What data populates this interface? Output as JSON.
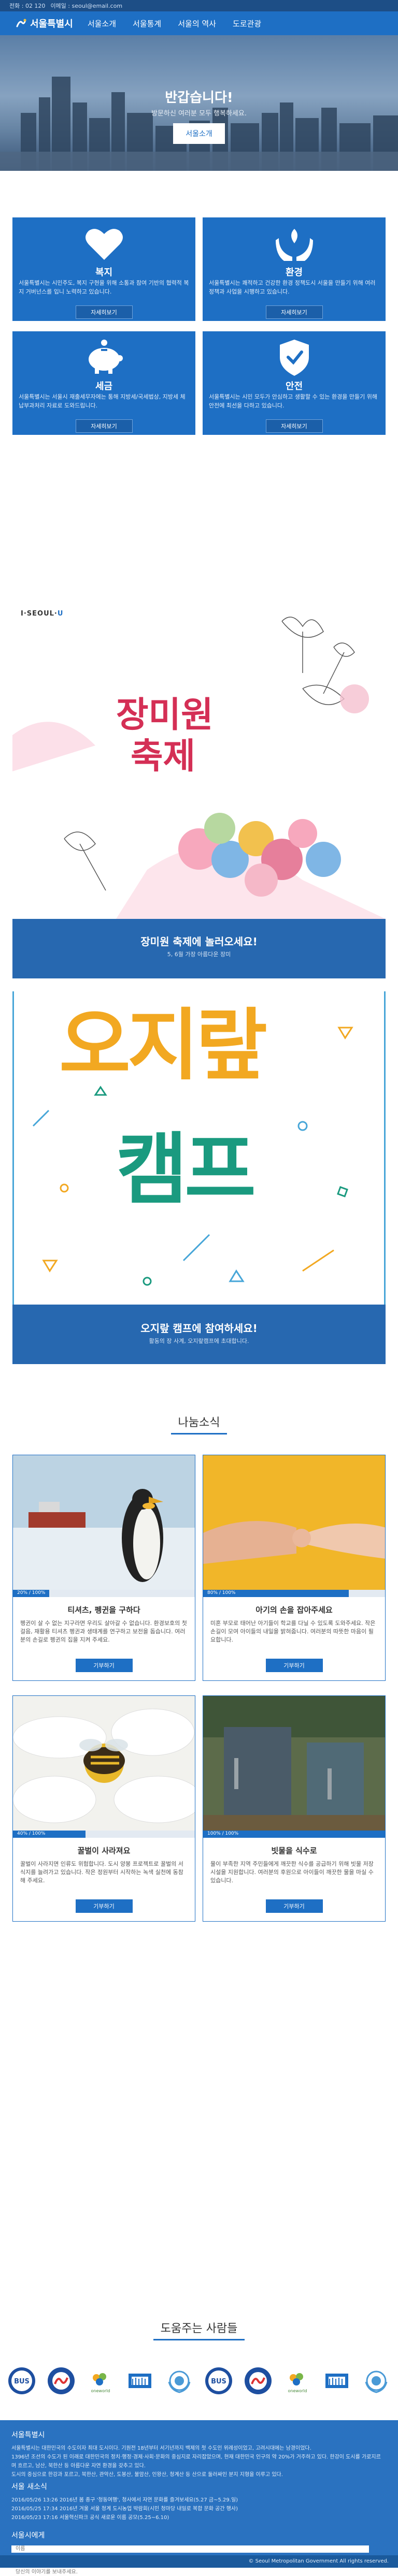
{
  "topbar": {
    "phone": "전화 : 02 120",
    "email": "이메일 : seoul@email.com"
  },
  "nav": {
    "logo": "서울특별시",
    "items": [
      "서울소개",
      "서울통계",
      "서울의 역사",
      "도로관광"
    ]
  },
  "hero": {
    "title": "반갑습니다!",
    "subtitle": "방문하신 여러분 모두 행복하세요.",
    "button": "서울소개"
  },
  "services": [
    {
      "title": "복지",
      "icon": "heart-icon",
      "desc": "서울특별시는 시민주도, 복지 구현을 위해 소통과 참여 기반의 협력적 복지 거버넌스를 입니 노력하고 있습니다.",
      "button": "자세히보기"
    },
    {
      "title": "환경",
      "icon": "hands-leaf-icon",
      "desc": "서울특별시는 쾌적하고 건강한 환경 정책도시 서울을 만들기 위해 여러 정책과 사업을 시행하고 있습니다.",
      "button": "자세히보기"
    },
    {
      "title": "세금",
      "icon": "piggy-bank-icon",
      "desc": "서울특별시는 서울시 재출세무자에는 통해 지방세/국세법상, 지방세 체납부과처리 자료로 도와드립니다.",
      "button": "자세히보기"
    },
    {
      "title": "안전",
      "icon": "shield-icon",
      "desc": "서울특별시는 시민 모두가 안심하고 생활할 수 있는 환경을 만들기 위해 안전에 최선을 다하고 있습니다.",
      "button": "자세히보기"
    }
  ],
  "rose_banner": {
    "logo_main": "I·SEOUL·",
    "logo_u": "U",
    "title_line1": "장미원",
    "title_line2": "축제",
    "caption_title": "장미원 축제에 놀러오세요!",
    "caption_sub": "5, 6월 가장 아름다운 장미"
  },
  "camp_banner": {
    "title_line1": "오지랖",
    "title_line2": "캠프",
    "caption_title": "오지랖 캠프에 참여하세요!",
    "caption_sub": "활동의 장 사계, 오지랖캠프에 초대합니다."
  },
  "donation_section": {
    "title": "나눔소식",
    "items": [
      {
        "title": "티셔츠, 펭귄을 구하다",
        "progress_label": "20% / 100%",
        "progress": 0.2,
        "desc": "펭귄이 살 수 없는 지구라면 우리도 살아갈 수 없습니다. 환경보호의 첫걸음, 재활용 티셔츠 펭귄과 생태계를 연구하고 보전을 돕습니다. 여러분의 손길로 펭귄의 집을 지켜 주세요.",
        "button": "기부하기"
      },
      {
        "title": "아기의 손을 잡아주세요",
        "progress_label": "80% / 100%",
        "progress": 0.8,
        "desc": "미혼 부모로 태어난 아기들이 학교를 다닐 수 있도록 도와주세요. 작은 손길이 모여 아이들의 내일을 밝혀줍니다. 여러분의 따뜻한 마음이 필요합니다.",
        "button": "기부하기"
      },
      {
        "title": "꿀벌이 사라져요",
        "progress_label": "40% / 100%",
        "progress": 0.4,
        "desc": "꿀벌이 사라지면 인류도 위험합니다. 도시 양봉 프로젝트로 꿀벌의 서식지를 늘려가고 있습니다. 작은 정원부터 시작하는 녹색 실천에 동참해 주세요.",
        "button": "기부하기"
      },
      {
        "title": "빗물을 식수로",
        "progress_label": "100% / 100%",
        "progress": 1.0,
        "desc": "물이 부족한 지역 주민들에게 깨끗한 식수를 공급하기 위해 빗물 저장 시설을 지원합니다. 여러분의 후원으로 아이들이 깨끗한 물을 마실 수 있습니다.",
        "button": "기부하기"
      }
    ]
  },
  "partners": {
    "title": "도움주는 사람들",
    "logos": [
      "bus-logo",
      "seoul-logo",
      "oneworld-logo",
      "un-logo",
      "wreath-logo",
      "bus-logo",
      "seoul-logo",
      "oneworld-logo",
      "un-logo",
      "wreath-logo"
    ],
    "labels": {
      "bus": "BUS",
      "oneworld": "oneworld"
    }
  },
  "footer": {
    "about_title": "서울특별시",
    "about_text_1": "서울특별시는 대한민국의 수도이자 최대 도시이다. 기원전 18년부터 서기년까지 백제의 첫 수도인 위례성이었고, 고려시대에는 남경이었다.",
    "about_text_2": "1396년 조선의 수도가 된 이래로 대한민국의 정치·행정·경제·사회·문화의 중심지로 자리잡았으며, 현재 대한민국 인구의 약 20%가 거주하고 있다. 한강이 도시를 가로지르며 흐르고, 남산, 북한산 등 아름다운 자연 환경을 갖추고 있다.",
    "about_text_3": "도시의 중심으로 한강과 포르고, 북한산, 관악산, 도봉산, 불암산, 인왕산, 청계산 등 산으로 둘러싸인 분지 지형을 이루고 있다.",
    "news_title": "서울 새소식",
    "news": [
      "2016/05/26 13:26 2016년 봄 종구 '청동여행', 청사에서 자연 문화를 즐겨보세요(5.27 금~5.29.일)",
      "2016/05/25 17:34 2016년 겨울 서울 청계 도시농업 박람회(시민 청마당 내일로 복합 문화 공간 행사)",
      "2016/05/23 17:16 서울혁신파크 공식 새로운 이름 공모(5.25~6.10)"
    ],
    "contact_title": "서울시에게",
    "name_placeholder": "이름",
    "email_placeholder": "이메일주소",
    "message_placeholder": "당신의 이야기를 보내주세요.",
    "send_button": "보내기",
    "copyright": "© Seoul Metropolitan Government All rights reserved."
  }
}
